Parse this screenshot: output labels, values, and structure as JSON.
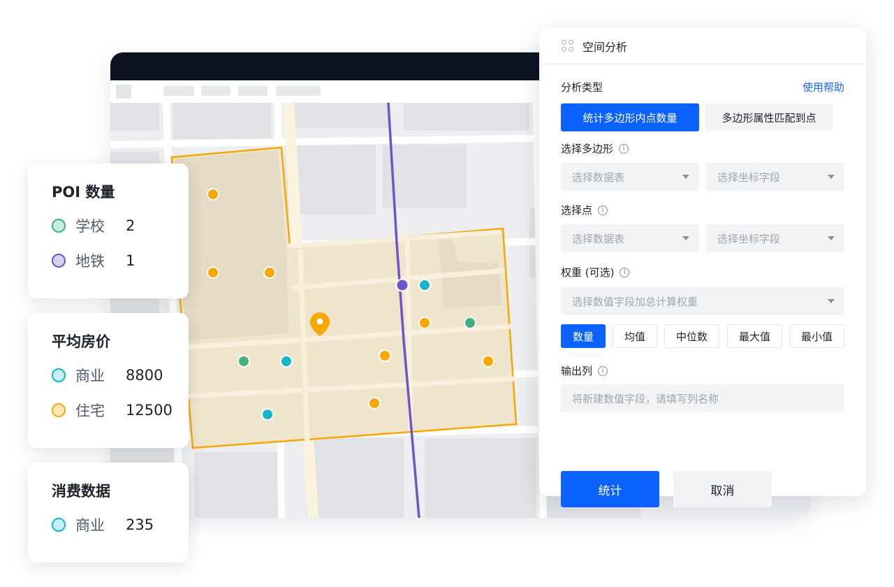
{
  "cards": [
    {
      "title": "POI 数量",
      "rows": [
        {
          "label": "学校",
          "value": "2",
          "dot_fill": "#c6ecdb",
          "dot_border": "#3fb27f"
        },
        {
          "label": "地铁",
          "value": "1",
          "dot_fill": "#d8d0f3",
          "dot_border": "#6c55c8"
        }
      ]
    },
    {
      "title": "平均房价",
      "rows": [
        {
          "label": "商业",
          "value": "8800",
          "dot_fill": "#c6f0f5",
          "dot_border": "#17b5cc"
        },
        {
          "label": "住宅",
          "value": "12500",
          "dot_fill": "#fde9b8",
          "dot_border": "#f5a800"
        }
      ]
    },
    {
      "title": "消费数据",
      "rows": [
        {
          "label": "商业",
          "value": "235",
          "dot_fill": "#c6f0f5",
          "dot_border": "#17b5cc"
        }
      ]
    }
  ],
  "panel": {
    "title": "空间分析",
    "analysis_type_label": "分析类型",
    "help_link": "使用帮助",
    "analysis_types": [
      {
        "label": "统计多边形内点数量",
        "active": true
      },
      {
        "label": "多边形属性匹配到点",
        "active": false
      }
    ],
    "polygon_label": "选择多边形",
    "polygon_table_placeholder": "选择数据表",
    "polygon_field_placeholder": "选择坐标字段",
    "point_label": "选择点",
    "point_table_placeholder": "选择数据表",
    "point_field_placeholder": "选择坐标字段",
    "weight_label": "权重 (可选)",
    "weight_placeholder": "选择数值字段加总计算权重",
    "aggregations": [
      {
        "label": "数量",
        "active": true
      },
      {
        "label": "均值",
        "active": false
      },
      {
        "label": "中位数",
        "active": false
      },
      {
        "label": "最大值",
        "active": false
      },
      {
        "label": "最小值",
        "active": false
      }
    ],
    "output_label": "输出列",
    "output_placeholder": "将新建数值字段，请填写列名称",
    "submit_label": "统计",
    "cancel_label": "取消"
  },
  "map": {
    "colors": {
      "polygon_fill": "#efe3c9",
      "polygon_border": "#f5a800",
      "metro_line": "#6c55c8",
      "residential": "#f5a800",
      "commercial": "#17b5cc",
      "school": "#3fb27f",
      "metro_station": "#6c55c8"
    }
  }
}
